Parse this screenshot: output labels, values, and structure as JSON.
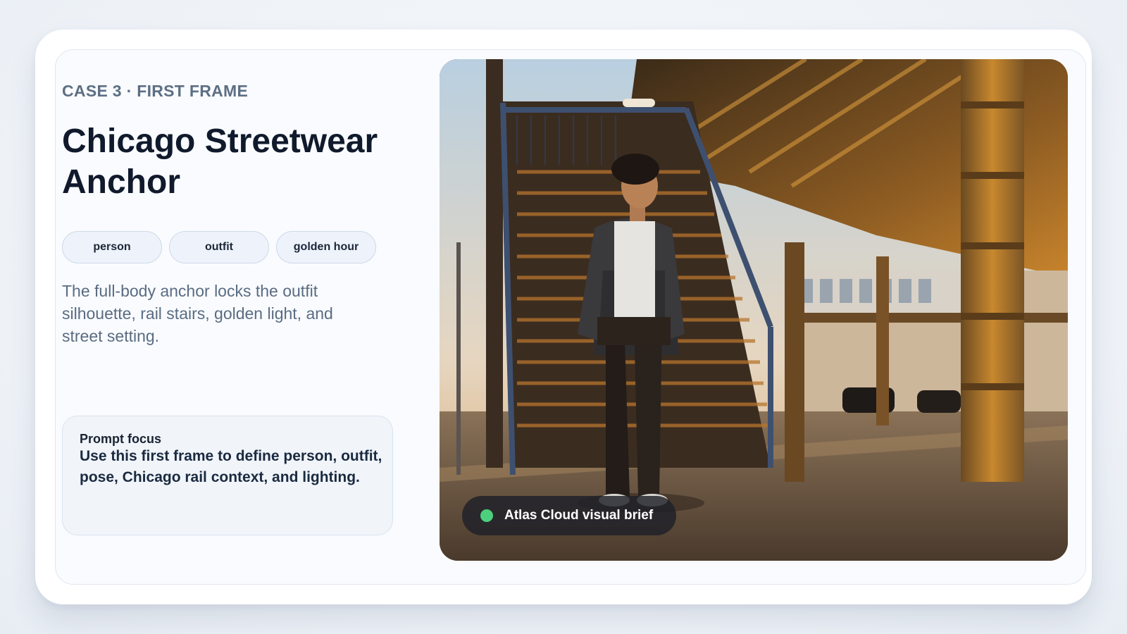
{
  "case": {
    "eyebrow": "CASE 3 · FIRST FRAME",
    "title": "Chicago Streetwear Anchor",
    "tags": [
      "person",
      "outfit",
      "golden hour"
    ],
    "description": "The full-body anchor locks the outfit silhouette, rail stairs, golden light, and street setting.",
    "prompt_focus": {
      "label": "Prompt focus",
      "text": "Use this first frame to define person, outfit, pose, Chicago rail context, and lighting."
    }
  },
  "photo": {
    "alt": "Young man in dark jacket and cargo pants standing in front of steel rail stairs under an elevated Chicago train track at golden hour",
    "badge": {
      "label": "Atlas Cloud visual brief",
      "status_color": "#4cd07d"
    }
  },
  "colors": {
    "title": "#101a2c",
    "eyebrow": "#5d6f84",
    "tag_bg": "#eef3fb",
    "card_bg": "#f9fbfe"
  }
}
